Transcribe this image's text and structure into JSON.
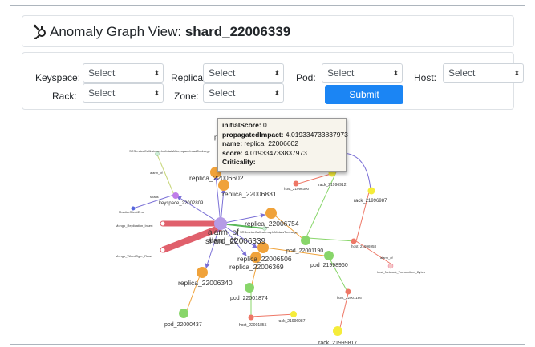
{
  "title": {
    "prefix": "Anomaly Graph View:",
    "shard": "shard_22006339"
  },
  "filters": {
    "keyspace": {
      "label": "Keyspace:",
      "value": "Select"
    },
    "replica": {
      "label": "Replica:",
      "value": "Select"
    },
    "pod": {
      "label": "Pod:",
      "value": "Select"
    },
    "host": {
      "label": "Host:",
      "value": "Select"
    },
    "rack": {
      "label": "Rack:",
      "value": "Select"
    },
    "zone": {
      "label": "Zone:",
      "value": "Select"
    },
    "submit_label": "Submit",
    "caret": "⬍"
  },
  "tooltip": {
    "initialScore": {
      "key": "initialScore:",
      "value": "0"
    },
    "propagatedImpact": {
      "key": "propagatedImpact:",
      "value": "4.019334733837973"
    },
    "name": {
      "key": "name:",
      "value": "replica_22006602"
    },
    "score": {
      "key": "score:",
      "value": "4.019334733837973"
    },
    "criticality": {
      "key": "Criticality:",
      "value": ""
    }
  },
  "graph": {
    "colors": {
      "shard": "#b59be6",
      "replica": "#f0a23a",
      "pod": "#88d66a",
      "host": "#ee7766",
      "rack": "#f5ec3a",
      "keyspace": "#c07ee8",
      "alarm": "#ccedd8",
      "monitor": "#5566dd",
      "edge_red": "#e0606c"
    },
    "labels": {
      "shard": "shard_22006339",
      "alarm1": "alarm_of",
      "alarm2": "alarm_of",
      "replica1": "replica_22006602",
      "replica2": "replica_22006831",
      "replica3": "replica_22006754",
      "replica4": "replica_22006506",
      "replica5": "replica_22006369",
      "replica6": "replica_22006340",
      "keyspace": "keyspace_22002809",
      "pod1": "pod_22001190",
      "pod2": "pod_21998960",
      "pod3": "pod_22001874",
      "pod4": "pod_22000437",
      "rack1": "rack_21996912",
      "rack2": "rack_21996987",
      "rack3": "rack_21999817",
      "rack4": "rack_21996987",
      "host1": "host_21996390",
      "host2": "host_21996958",
      "host3": "host_22001186",
      "host4": "host_22001855",
      "pod_top": "pod",
      "cut_label": "pc",
      "alarm_top": "SRServiceCallLatencyInMotatsMkeyspaceLoadTooLarge",
      "alarm_top_edge": "alarm_of",
      "alarm_mid": "SRServiceCallLatencyInMotatsTooLarge",
      "alarm_left1": "Mongo_Replication_Insert",
      "alarm_left2": "Mongo_WiredTiger_Read",
      "monitor": "MonitorClientError",
      "keyspace_edge": "spans",
      "host_metric": "host_Network_Transmitted_Bytes",
      "host_metric_edge": "alarm_of",
      "rack_small": "966",
      "host_top": "host"
    }
  }
}
